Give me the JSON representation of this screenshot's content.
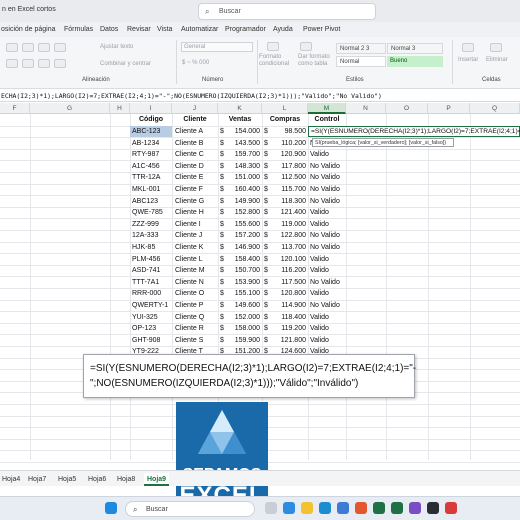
{
  "window": {
    "title": "n en Excel cortos",
    "search_placeholder": "Buscar"
  },
  "menu": [
    "osición de página",
    "Fórmulas",
    "Datos",
    "Revisar",
    "Vista",
    "Automatizar",
    "Programador",
    "Ayuda",
    "Power Pivot"
  ],
  "ribbon": {
    "wrap_text": "Ajustar texto",
    "merge_center": "Combinar y centrar",
    "number_format": "General",
    "cond_format": "Formato condicional",
    "format_table": "Dar formato como tabla",
    "style_normal23": "Normal 2 3",
    "style_normal3": "Normal 3",
    "style_normal": "Normal",
    "style_bueno": "Bueno",
    "insert": "Insertar",
    "delete": "Eliminar",
    "groups": {
      "alignment": "Alineación",
      "number": "Número",
      "styles": "Estilos",
      "cells": "Celdas"
    }
  },
  "formula_bar": {
    "text": "ECHA(I2;3)*1);LARGO(I2)=7;EXTRAE(I2;4;1)=\"-\";NO(ESNUMERO(IZQUIERDA(I2;3)*1)));\"Valido\";\"No Valido\")"
  },
  "columns": [
    "F",
    "G",
    "H",
    "I",
    "J",
    "K",
    "L",
    "M",
    "N",
    "O",
    "P",
    "Q"
  ],
  "table": {
    "headers": [
      "Código",
      "Cliente",
      "Ventas",
      "Compras",
      "Control"
    ],
    "currency": "$",
    "rows": [
      [
        "ABC-123",
        "Cliente A",
        "154.000",
        "98.500",
        ""
      ],
      [
        "AB-1234",
        "Cliente B",
        "143.500",
        "110.200",
        "N"
      ],
      [
        "RTY-987",
        "Cliente C",
        "159.700",
        "120.900",
        "Valido"
      ],
      [
        "A1C-456",
        "Cliente D",
        "148.300",
        "117.800",
        "No Valido"
      ],
      [
        "TTR-12A",
        "Cliente E",
        "151.000",
        "112.500",
        "No Valido"
      ],
      [
        "MKL-001",
        "Cliente F",
        "160.400",
        "115.700",
        "No Valido"
      ],
      [
        "ABC123",
        "Cliente G",
        "149.900",
        "118.300",
        "No Valido"
      ],
      [
        "QWE-785",
        "Cliente H",
        "152.800",
        "121.400",
        "Valido"
      ],
      [
        "ZZZ-999",
        "Cliente I",
        "155.600",
        "119.000",
        "Valido"
      ],
      [
        "12A-333",
        "Cliente J",
        "157.200",
        "122.800",
        "No Valido"
      ],
      [
        "HJK-85",
        "Cliente K",
        "146.900",
        "113.700",
        "No Valido"
      ],
      [
        "PLM-456",
        "Cliente L",
        "158.400",
        "120.100",
        "Valido"
      ],
      [
        "ASD-741",
        "Cliente M",
        "150.700",
        "116.200",
        "Valido"
      ],
      [
        "TTT-7A1",
        "Cliente N",
        "153.900",
        "117.500",
        "No Valido"
      ],
      [
        "RRR-000",
        "Cliente O",
        "155.100",
        "120.800",
        "Valido"
      ],
      [
        "QWERTY-1",
        "Cliente P",
        "149.600",
        "114.900",
        "No Valido"
      ],
      [
        "YUI-325",
        "Cliente Q",
        "152.000",
        "118.400",
        "Valido"
      ],
      [
        "OP-123",
        "Cliente R",
        "158.000",
        "119.200",
        "Valido"
      ],
      [
        "GHT-908",
        "Cliente S",
        "159.900",
        "121.800",
        "Valido"
      ],
      [
        "YT9-222",
        "Cliente T",
        "151.200",
        "124.600",
        "Valido"
      ]
    ]
  },
  "active_cell": {
    "text": "=SI(Y(ESNUMERO(DERECHA(I2;3)*1);LARGO(I2)=7;EXTRAE(I2;4;1)=\"-\"",
    "tooltip": "SI(prueba_lógica; [valor_si_verdadero]; [valor_si_falso])"
  },
  "callout": {
    "line1": "=SI(Y(ESNUMERO(DERECHA(I2;3)*1);LARGO(I2)=7;EXTRAE(I2;4;1)=\"-",
    "line2": "\";NO(ESNUMERO(IZQUIERDA(I2;3)*1)));\"Válido\";\"Inválido\")"
  },
  "logo": {
    "line1": "SEPAMOS",
    "line2": "EXCEL"
  },
  "sheet_tabs": [
    "Hoja4",
    "Hoja7",
    "Hoja5",
    "Hoja6",
    "Hoja8",
    "Hoja9"
  ],
  "active_tab": "Hoja9",
  "taskbar": {
    "search_label": "Buscar"
  },
  "colors": {
    "excel_green": "#1e7145",
    "selection_blue": "#b8cce4",
    "logo_blue": "#1a6aa9"
  }
}
